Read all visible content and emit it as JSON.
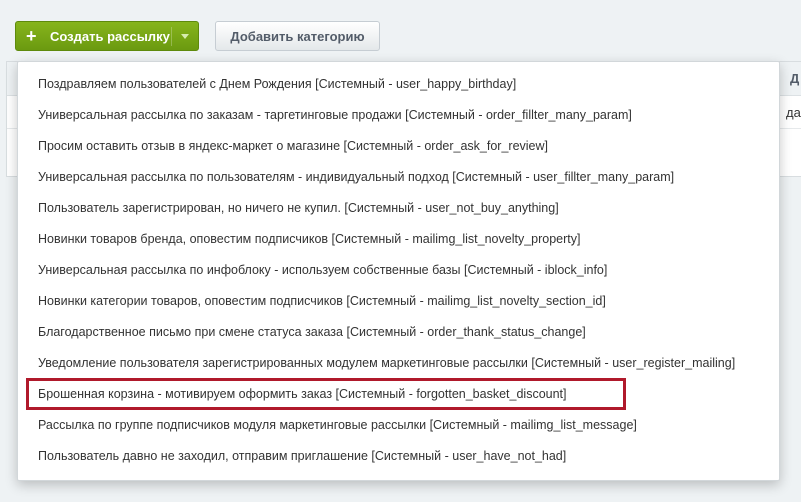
{
  "toolbar": {
    "create_label": "Создать рассылку",
    "add_category_label": "Добавить категорию"
  },
  "background_table": {
    "header_fragment": "Д",
    "cell_fragment": "да"
  },
  "menu": {
    "items": [
      "Поздравляем пользователей с Днем Рождения [Системный - user_happy_birthday]",
      "Универсальная рассылка по заказам - таргетинговые продажи [Системный - order_fillter_many_param]",
      "Просим оставить отзыв в яндекс-маркет о магазине [Системный - order_ask_for_review]",
      "Универсальная рассылка по пользователям - индивидуальный подход [Системный - user_fillter_many_param]",
      "Пользователь зарегистрирован, но ничего не купил. [Системный - user_not_buy_anything]",
      "Новинки товаров бренда, оповестим подписчиков [Системный - mailimg_list_novelty_property]",
      "Универсальная рассылка по инфоблоку - используем собственные базы [Системный - iblock_info]",
      "Новинки категории товаров, оповестим подписчиков [Системный - mailimg_list_novelty_section_id]",
      "Благодарственное письмо при смене статуса заказа [Системный - order_thank_status_change]",
      "Уведомление пользователя зарегистрированных модулем маркетинговые рассылки [Системный - user_register_mailing]",
      "Брошенная корзина - мотивируем оформить заказ [Системный - forgotten_basket_discount]",
      "Рассылка по группе подписчиков модуля маркетинговые рассылки [Системный - mailimg_list_message]",
      "Пользователь давно не заходил, отправим приглашение [Системный - user_have_not_had]"
    ],
    "highlighted_index": 10
  },
  "colors": {
    "primary_button": "#7aab14",
    "highlight_border": "#b0192b",
    "background": "#eef2f4"
  }
}
